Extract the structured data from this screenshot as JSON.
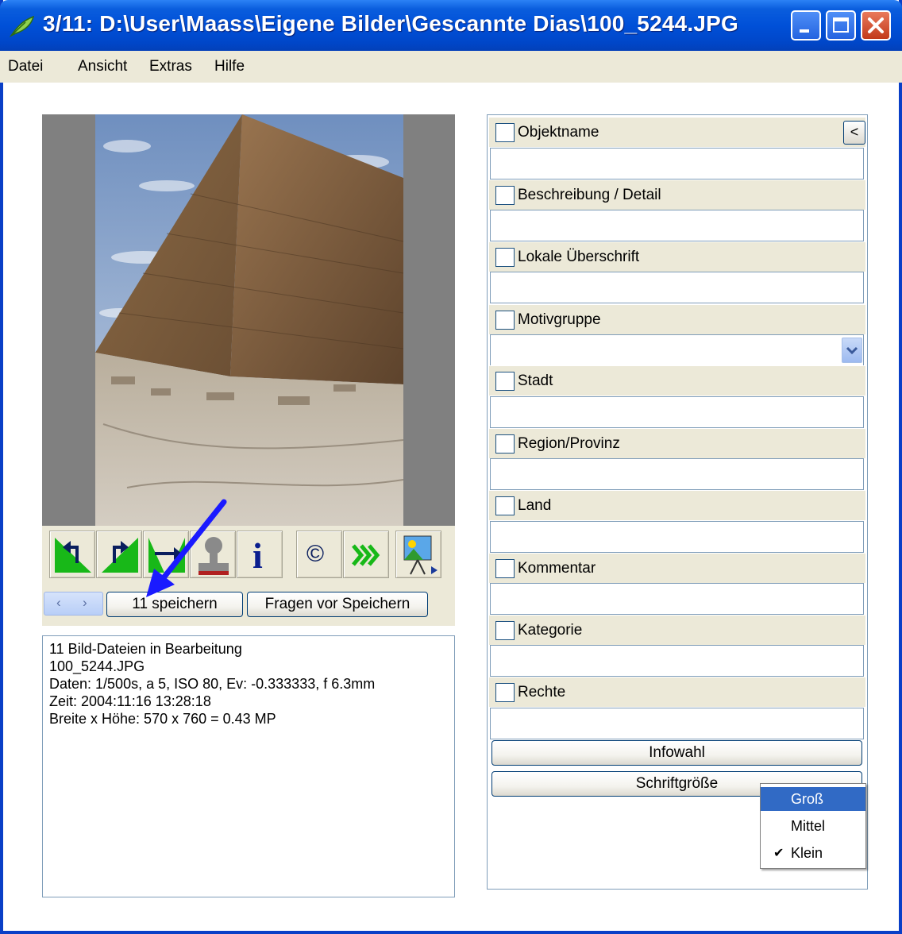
{
  "window": {
    "title": "3/11: D:\\User\\Maass\\Eigene Bilder\\Gescannte Dias\\100_5244.JPG"
  },
  "menu": {
    "items": [
      "Datei",
      "Ansicht",
      "Extras",
      "Hilfe"
    ]
  },
  "toolbar": {
    "icons": [
      "rotate-left-icon",
      "rotate-right-icon",
      "flip-icon",
      "stamp-icon",
      "info-icon",
      "copyright-icon",
      "forward-icon",
      "slideshow-icon"
    ],
    "info_glyph": "i",
    "copyright_glyph": "©"
  },
  "nav": {
    "save_label": "11 speichern",
    "ask_label": "Fragen vor Speichern"
  },
  "info": {
    "lines": [
      "11 Bild-Dateien in Bearbeitung",
      "100_5244.JPG",
      "Daten: 1/500s, a 5, ISO 80, Ev: -0.333333, f 6.3mm",
      "Zeit: 2004:11:16 13:28:18",
      "Breite x Höhe: 570 x 760 = 0.43 MP"
    ]
  },
  "fields": [
    {
      "label": "Objektname",
      "value": ""
    },
    {
      "label": "Beschreibung / Detail",
      "value": ""
    },
    {
      "label": "Lokale Überschrift",
      "value": ""
    },
    {
      "label": "Motivgruppe",
      "value": ""
    },
    {
      "label": "Stadt",
      "value": ""
    },
    {
      "label": "Region/Provinz",
      "value": ""
    },
    {
      "label": "Land",
      "value": ""
    },
    {
      "label": "Kommentar",
      "value": ""
    },
    {
      "label": "Kategorie",
      "value": ""
    },
    {
      "label": "Rechte",
      "value": ""
    }
  ],
  "buttons": {
    "collapse": "<",
    "infowahl": "Infowahl",
    "schriftgroesse": "Schriftgröße"
  },
  "font_size_menu": {
    "items": [
      "Groß",
      "Mittel",
      "Klein"
    ],
    "highlighted": "Groß",
    "checked": "Klein",
    "check_glyph": "✔"
  },
  "colors": {
    "titlebar": "#0050d8",
    "menu_bg": "#ece9d8",
    "highlight": "#316ac5",
    "arrow": "#1a1aff"
  }
}
